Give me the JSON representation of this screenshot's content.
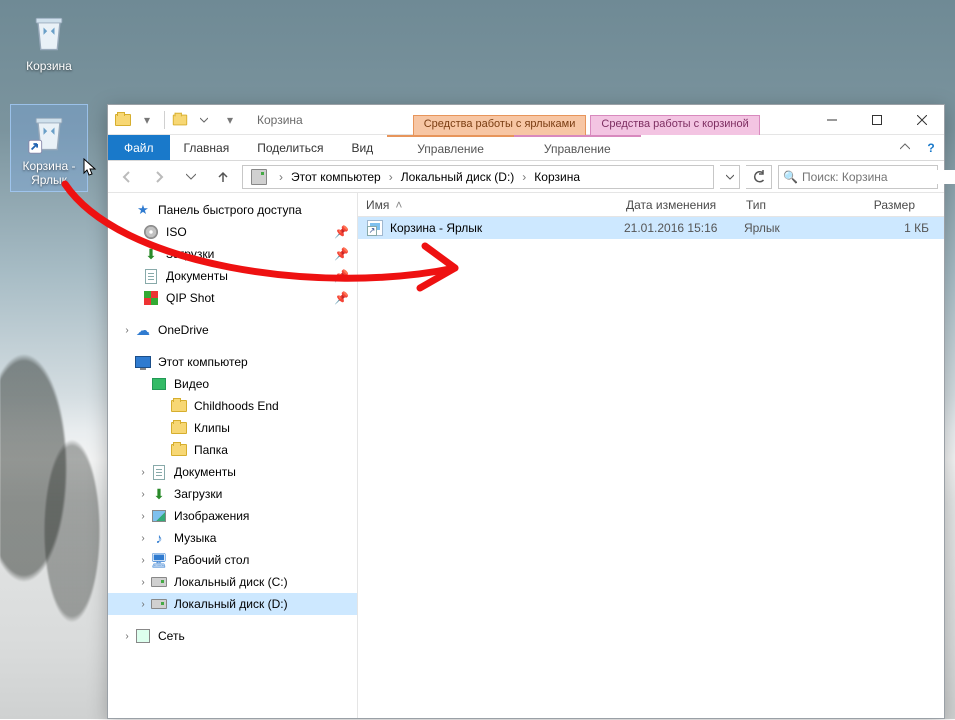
{
  "desktop_icons": [
    {
      "label": "Корзина"
    },
    {
      "label": "Корзина - Ярлык"
    }
  ],
  "window": {
    "title": "Корзина",
    "context_tabs": [
      "Средства работы с ярлыками",
      "Средства работы с корзиной"
    ],
    "ribbon": {
      "file": "Файл",
      "tabs": [
        "Главная",
        "Поделиться",
        "Вид"
      ],
      "context_sub": [
        "Управление",
        "Управление"
      ]
    },
    "breadcrumb": [
      "Этот компьютер",
      "Локальный диск (D:)",
      "Корзина"
    ],
    "search_placeholder": "Поиск: Корзина",
    "columns": {
      "name": "Имя",
      "date": "Дата изменения",
      "type": "Тип",
      "size": "Размер"
    },
    "file": {
      "name": "Корзина - Ярлык",
      "date": "21.01.2016 15:16",
      "type": "Ярлык",
      "size": "1 КБ"
    },
    "tree": {
      "quick_access": "Панель быстрого доступа",
      "qa_items": [
        "ISO",
        "Загрузки",
        "Документы",
        "QIP Shot"
      ],
      "onedrive": "OneDrive",
      "this_pc": "Этот компьютер",
      "pc_items": {
        "video": "Видео",
        "video_sub": [
          "Childhoods End",
          "Клипы",
          "Папка"
        ],
        "documents": "Документы",
        "downloads": "Загрузки",
        "pictures": "Изображения",
        "music": "Музыка",
        "desktop": "Рабочий стол",
        "drive_c": "Локальный диск (C:)",
        "drive_d": "Локальный диск (D:)"
      },
      "network": "Сеть"
    }
  }
}
